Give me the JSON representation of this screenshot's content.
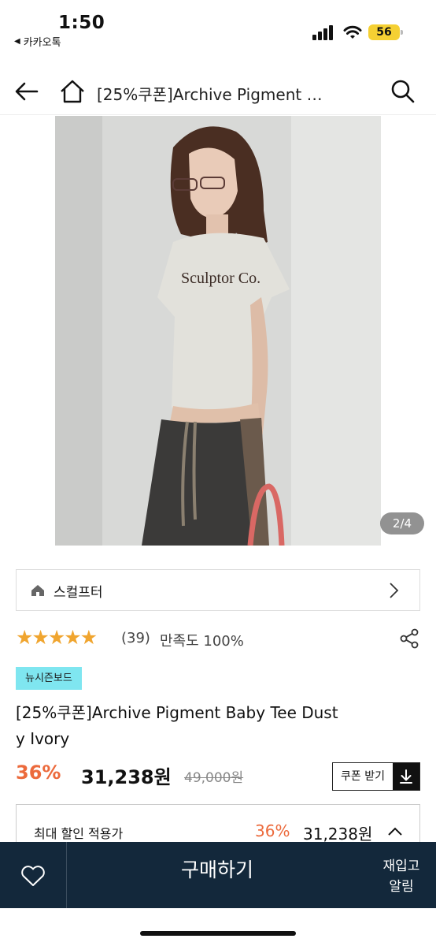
{
  "status_bar": {
    "time": "1:50",
    "back_app": "카카오톡",
    "battery": "56"
  },
  "nav": {
    "title": "[25%쿠폰]Archive Pigment …"
  },
  "image": {
    "counter": "2/4",
    "shirt_text": "Sculptor Co."
  },
  "brand": {
    "name": "스컬프터"
  },
  "rating": {
    "stars": "★★★★★",
    "review_count": "(39)",
    "satisfaction": "만족도 100%"
  },
  "badge": "뉴시즌보드",
  "product": {
    "title_line1": "[25%쿠폰]Archive Pigment Baby Tee Dust",
    "title_line2": "y Ivory",
    "discount": "36%",
    "sale_price": "31,238원",
    "original_price": "49,000원",
    "coupon_label": "쿠폰 받기"
  },
  "max_discount": {
    "label": "최대 할인 적용가",
    "percent": "36%",
    "price": "31,238원"
  },
  "bottom_bar": {
    "buy_label": "구매하기",
    "restock_line1": "재입고",
    "restock_line2": "알림"
  },
  "colors": {
    "accent_orange": "#ec6a3c",
    "star": "#f0a52f",
    "badge_bg": "#7fe6f0",
    "bottom_bar_bg": "#13283b",
    "battery_bg": "#f5d033"
  }
}
